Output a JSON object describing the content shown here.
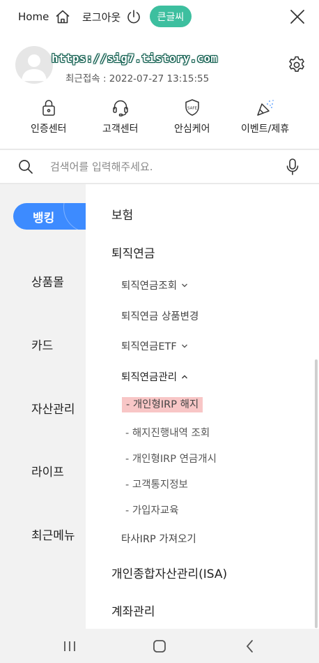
{
  "topbar": {
    "home_label": "Home",
    "logout_label": "로그아웃",
    "bigfont_label": "큰글씨"
  },
  "profile": {
    "watermark": "https://sig7.tistory.com",
    "last_login": "최근접속 : 2022-07-27 13:15:55"
  },
  "quick_menu": [
    {
      "label": "인증센터",
      "icon": "lock-icon"
    },
    {
      "label": "고객센터",
      "icon": "headset-icon"
    },
    {
      "label": "안심케어",
      "icon": "safe-shield-icon",
      "icon_text": "SAFE"
    },
    {
      "label": "이벤트/제휴",
      "icon": "party-popper-icon"
    }
  ],
  "search": {
    "placeholder": "검색어를 입력해주세요."
  },
  "categories": [
    {
      "label": "뱅킹",
      "active": true
    },
    {
      "label": "상품몰"
    },
    {
      "label": "카드"
    },
    {
      "label": "자산관리"
    },
    {
      "label": "라이프"
    },
    {
      "label": "최근메뉴"
    }
  ],
  "menu": {
    "insurance": "보험",
    "pension": "퇴직연금",
    "pension_inquiry": "퇴직연금조회",
    "pension_product_change": "퇴직연금 상품변경",
    "pension_etf": "퇴직연금ETF",
    "pension_management": "퇴직연금관리",
    "sub": [
      "- 개인형IRP 해지",
      "- 해지진행내역 조회",
      "- 개인형IRP 연금개시",
      "- 고객통지정보",
      "- 가입자교육"
    ],
    "other_irp": "타사IRP 가져오기",
    "isa": "개인종합자산관리(ISA)",
    "account_management": "계좌관리"
  },
  "colors": {
    "accent_green": "#3dbf9f",
    "accent_blue": "#3d8bff",
    "highlight_pink": "#f8c6c6"
  }
}
